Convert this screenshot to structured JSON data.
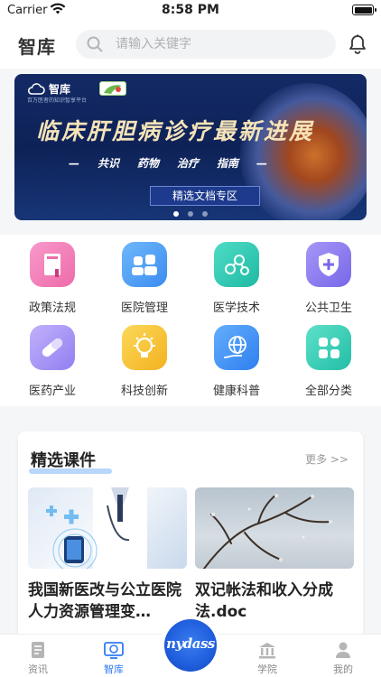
{
  "status_bar": {
    "carrier": "Carrier",
    "time": "8:58 PM"
  },
  "header": {
    "title": "智库",
    "search_placeholder": "请输入关键字"
  },
  "banner": {
    "brand": "智库",
    "brand_sub": "百万医者的知识智享平台",
    "headline": "临床肝胆病诊疗最新进展",
    "tags": [
      "共识",
      "药物",
      "治疗",
      "指南"
    ],
    "button_label": "精选文档专区",
    "slide_count": 3,
    "active_slide": 1
  },
  "categories": [
    {
      "label": "政策法规",
      "icon": "book-icon",
      "color": "#f37fb8"
    },
    {
      "label": "医院管理",
      "icon": "people-icon",
      "color": "#4a9ef5"
    },
    {
      "label": "医学技术",
      "icon": "molecule-icon",
      "color": "#2fcdb5"
    },
    {
      "label": "公共卫生",
      "icon": "shield-plus-icon",
      "color": "#8a7cf0"
    },
    {
      "label": "医药产业",
      "icon": "pill-icon",
      "color": "#a58ff2"
    },
    {
      "label": "科技创新",
      "icon": "lightbulb-icon",
      "color": "#f7c33a"
    },
    {
      "label": "健康科普",
      "icon": "globe-hand-icon",
      "color": "#3c8ff2"
    },
    {
      "label": "全部分类",
      "icon": "grid-icon",
      "color": "#35cdb6"
    }
  ],
  "featured": {
    "title": "精选课件",
    "more_label": "更多 >>",
    "courses": [
      {
        "title": "我国新医改与公立医院人力资源管理变…"
      },
      {
        "title": "双记帐法和收入分成法.doc"
      }
    ]
  },
  "tabbar": {
    "tabs": [
      {
        "label": "资讯",
        "active": false
      },
      {
        "label": "智库",
        "active": true
      },
      {
        "label": "学院",
        "active": false
      },
      {
        "label": "我的",
        "active": false
      }
    ],
    "center_logo": "nydass"
  },
  "colors": {
    "accent": "#2f7bf6",
    "banner_bg": "#142a66"
  }
}
